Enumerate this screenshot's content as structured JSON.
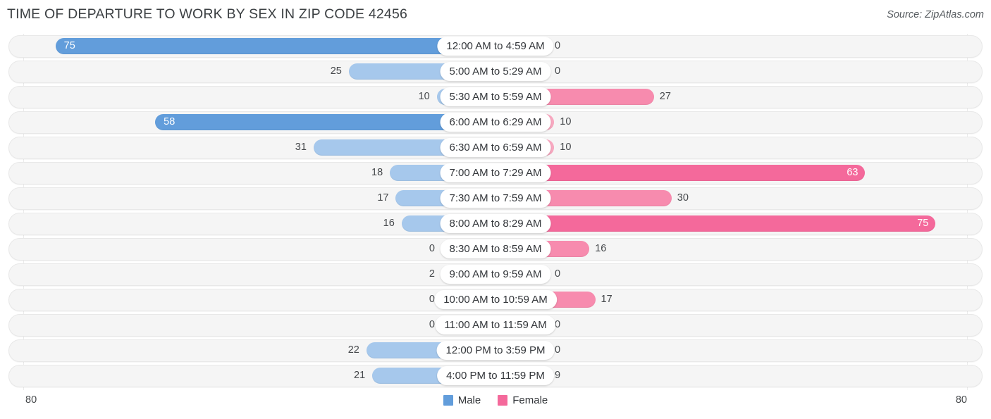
{
  "header": {
    "title": "TIME OF DEPARTURE TO WORK BY SEX IN ZIP CODE 42456",
    "source": "Source: ZipAtlas.com"
  },
  "legend": {
    "male_label": "Male",
    "female_label": "Female",
    "male_color": "#629DDB",
    "female_color": "#F4699B"
  },
  "axis": {
    "min_label": "80",
    "max_label": "80"
  },
  "chart_data": {
    "type": "bar",
    "title": "TIME OF DEPARTURE TO WORK BY SEX IN ZIP CODE 42456",
    "subtitle": "Source: ZipAtlas.com",
    "orientation": "horizontal-diverging",
    "xlabel": "",
    "ylabel": "",
    "xlim": [
      80,
      80
    ],
    "grid": true,
    "legend_position": "bottom-center",
    "categories": [
      "12:00 AM to 4:59 AM",
      "5:00 AM to 5:29 AM",
      "5:30 AM to 5:59 AM",
      "6:00 AM to 6:29 AM",
      "6:30 AM to 6:59 AM",
      "7:00 AM to 7:29 AM",
      "7:30 AM to 7:59 AM",
      "8:00 AM to 8:29 AM",
      "8:30 AM to 8:59 AM",
      "9:00 AM to 9:59 AM",
      "10:00 AM to 10:59 AM",
      "11:00 AM to 11:59 AM",
      "12:00 PM to 3:59 PM",
      "4:00 PM to 11:59 PM"
    ],
    "series": [
      {
        "name": "Male",
        "values": [
          75,
          25,
          10,
          58,
          31,
          18,
          17,
          16,
          0,
          2,
          0,
          0,
          22,
          21
        ]
      },
      {
        "name": "Female",
        "values": [
          0,
          0,
          27,
          10,
          10,
          63,
          30,
          75,
          16,
          0,
          17,
          0,
          0,
          9
        ]
      }
    ]
  },
  "rows": [
    {
      "label": "12:00 AM to 4:59 AM",
      "male": "75",
      "female": "0"
    },
    {
      "label": "5:00 AM to 5:29 AM",
      "male": "25",
      "female": "0"
    },
    {
      "label": "5:30 AM to 5:59 AM",
      "male": "10",
      "female": "27"
    },
    {
      "label": "6:00 AM to 6:29 AM",
      "male": "58",
      "female": "10"
    },
    {
      "label": "6:30 AM to 6:59 AM",
      "male": "31",
      "female": "10"
    },
    {
      "label": "7:00 AM to 7:29 AM",
      "male": "18",
      "female": "63"
    },
    {
      "label": "7:30 AM to 7:59 AM",
      "male": "17",
      "female": "30"
    },
    {
      "label": "8:00 AM to 8:29 AM",
      "male": "16",
      "female": "75"
    },
    {
      "label": "8:30 AM to 8:59 AM",
      "male": "0",
      "female": "16"
    },
    {
      "label": "9:00 AM to 9:59 AM",
      "male": "2",
      "female": "0"
    },
    {
      "label": "10:00 AM to 10:59 AM",
      "male": "0",
      "female": "17"
    },
    {
      "label": "11:00 AM to 11:59 AM",
      "male": "0",
      "female": "0"
    },
    {
      "label": "12:00 PM to 3:59 PM",
      "male": "22",
      "female": "0"
    },
    {
      "label": "4:00 PM to 11:59 PM",
      "male": "21",
      "female": "9"
    }
  ]
}
